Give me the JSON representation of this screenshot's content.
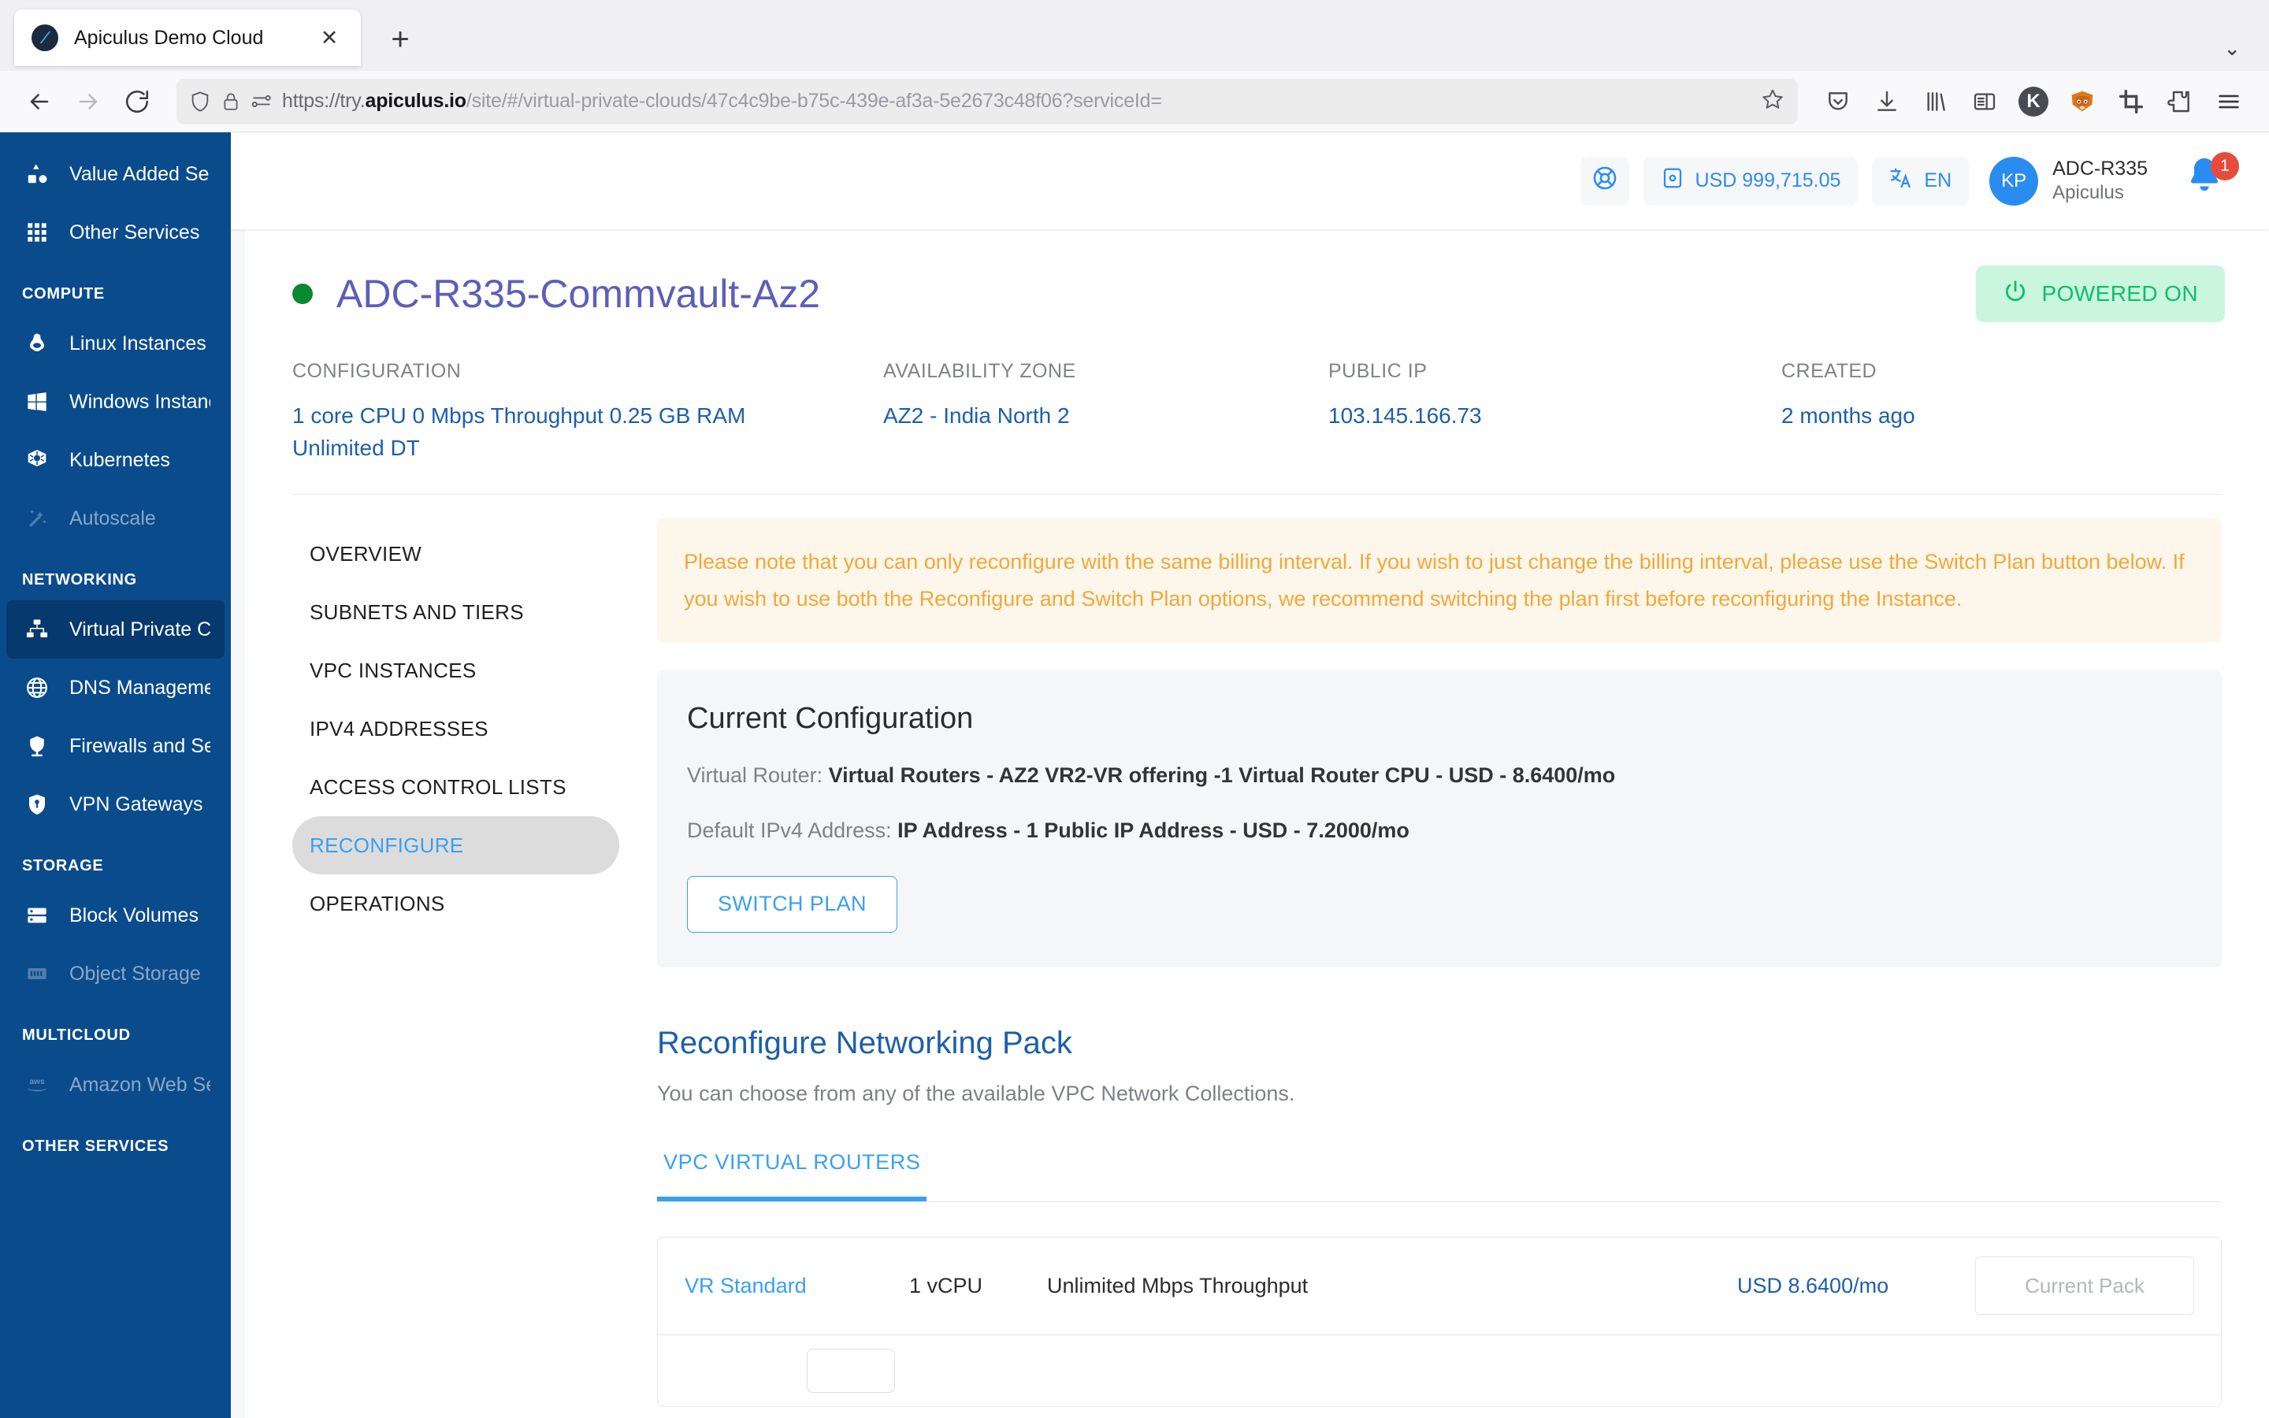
{
  "browser": {
    "tab": {
      "title": "Apiculus Demo Cloud",
      "favicon": "apiculus-logo-icon",
      "close_label": "✕"
    },
    "new_tab_label": "+",
    "tab_list_label": "⌄",
    "url_prefix": "https://try.",
    "url_domain": "apiculus.io",
    "url_path": "/site/#/virtual-private-clouds/47c4c9be-b75c-439e-af3a-5e2673c48f06?serviceId=",
    "toolbar_icons": [
      "pocket-icon",
      "downloads-icon",
      "library-icon",
      "reader-view-icon",
      "kasper-extension-icon",
      "metamask-icon",
      "screenshot-crop-icon",
      "extensions-puzzle-icon",
      "hamburger-menu-icon"
    ],
    "kasper_label": "K"
  },
  "sidebar": {
    "items": [
      {
        "label": "Value Added Services",
        "icon": "shapes-icon",
        "state": "normal"
      },
      {
        "label": "Other Services",
        "icon": "grid-icon",
        "state": "normal"
      }
    ],
    "sections": [
      {
        "title": "COMPUTE",
        "items": [
          {
            "label": "Linux Instances",
            "icon": "linux-penguin-icon",
            "state": "normal"
          },
          {
            "label": "Windows Instances",
            "icon": "windows-icon",
            "state": "normal"
          },
          {
            "label": "Kubernetes",
            "icon": "kubernetes-icon",
            "state": "normal"
          },
          {
            "label": "Autoscale",
            "icon": "magic-wand-icon",
            "state": "disabled"
          }
        ]
      },
      {
        "title": "NETWORKING",
        "items": [
          {
            "label": "Virtual Private Clouds",
            "icon": "network-topology-icon",
            "state": "active"
          },
          {
            "label": "DNS Management",
            "icon": "globe-icon",
            "state": "normal"
          },
          {
            "label": "Firewalls and Security",
            "icon": "firewall-icon",
            "state": "normal"
          },
          {
            "label": "VPN Gateways",
            "icon": "shield-key-icon",
            "state": "normal"
          }
        ]
      },
      {
        "title": "STORAGE",
        "items": [
          {
            "label": "Block Volumes",
            "icon": "server-stack-icon",
            "state": "normal"
          },
          {
            "label": "Object Storage",
            "icon": "storage-bucket-icon",
            "state": "disabled"
          }
        ]
      },
      {
        "title": "MULTICLOUD",
        "items": [
          {
            "label": "Amazon Web Services",
            "icon": "aws-icon",
            "state": "disabled"
          }
        ]
      },
      {
        "title": "OTHER SERVICES",
        "items": []
      }
    ]
  },
  "topbar": {
    "support_icon": "lifebuoy-icon",
    "wallet_icon": "wallet-icon",
    "balance": "USD 999,715.05",
    "language_icon": "translate-icon",
    "language": "EN",
    "avatar_initials": "KP",
    "user_name": "ADC-R335",
    "user_org": "Apiculus",
    "bell_icon": "notification-bell-icon",
    "notification_count": "1"
  },
  "page": {
    "status": "online",
    "title": "ADC-R335-Commvault-Az2",
    "power_icon": "power-icon",
    "power_label": "POWERED ON",
    "meta": [
      {
        "label": "CONFIGURATION",
        "value": "1 core CPU 0 Mbps Throughput 0.25 GB RAM Unlimited DT"
      },
      {
        "label": "AVAILABILITY ZONE",
        "value": "AZ2 - India North 2"
      },
      {
        "label": "PUBLIC IP",
        "value": "103.145.166.73"
      },
      {
        "label": "CREATED",
        "value": "2 months ago"
      }
    ]
  },
  "side_menu": {
    "items": [
      {
        "label": "OVERVIEW",
        "active": false
      },
      {
        "label": "SUBNETS AND TIERS",
        "active": false
      },
      {
        "label": "VPC INSTANCES",
        "active": false
      },
      {
        "label": "IPV4 ADDRESSES",
        "active": false
      },
      {
        "label": "ACCESS CONTROL LISTS",
        "active": false
      },
      {
        "label": "RECONFIGURE",
        "active": true
      },
      {
        "label": "OPERATIONS",
        "active": false
      }
    ]
  },
  "notice": {
    "text": "Please note that you can only reconfigure with the same billing interval. If you wish to just change the billing interval, please use the Switch Plan button below. If you wish to use both the Reconfigure and Switch Plan options, we recommend switching the plan first before reconfiguring the Instance."
  },
  "current_config": {
    "title": "Current Configuration",
    "rows": [
      {
        "label": "Virtual Router:",
        "value": "Virtual Routers - AZ2 VR2-VR offering -1 Virtual Router CPU - USD - 8.6400/mo"
      },
      {
        "label": "Default IPv4 Address:",
        "value": "IP Address - 1 Public IP Address - USD - 7.2000/mo"
      }
    ],
    "switch_plan_label": "SWITCH PLAN"
  },
  "reconfigure": {
    "title": "Reconfigure Networking Pack",
    "subtitle": "You can choose from any of the available VPC Network Collections.",
    "tabs": [
      {
        "label": "VPC VIRTUAL ROUTERS",
        "active": true
      }
    ],
    "table": {
      "rows": [
        {
          "name": "VR Standard",
          "cpu": "1 vCPU",
          "throughput": "Unlimited Mbps Throughput",
          "price": "USD 8.6400/mo",
          "action": "Current Pack"
        }
      ]
    }
  },
  "colors": {
    "sidebar_bg": "#0a4b8c",
    "sidebar_active": "#06396d",
    "accent_blue": "#3aa0f0",
    "link_blue": "#1d5faa",
    "title_purple": "#5c5fb8",
    "status_green": "#0a8a2e",
    "power_green": "#0fbe6a",
    "power_bg": "#c9f6dd",
    "notice_bg": "#fdf6ea",
    "notice_text": "#f0a93b",
    "badge_red": "#e74b3c"
  }
}
